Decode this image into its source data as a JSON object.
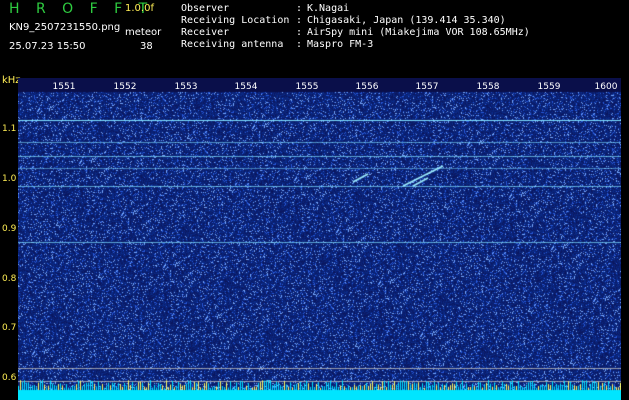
{
  "header": {
    "logo": "H R O F F T",
    "version": "1.0.0f",
    "filename": "KN9_2507231550.png",
    "mode": "meteor",
    "datetime": "25.07.23 15:50",
    "count": "38",
    "info": [
      {
        "label": "Observer",
        "value": "K.Nagai"
      },
      {
        "label": "Receiving Location",
        "value": "Chigasaki, Japan (139.414 35.340)"
      },
      {
        "label": "Receiver",
        "value": "AirSpy mini (Miakejima VOR 108.65MHz)"
      },
      {
        "label": "Receiving antenna",
        "value": "Maspro FM-3"
      }
    ],
    "separator": ":"
  },
  "axes": {
    "y_unit": "kHz",
    "y_ticks": [
      "1.1",
      "1.0",
      "0.9",
      "0.8",
      "0.7",
      "0.6"
    ],
    "x_ticks": [
      "1551",
      "1552",
      "1553",
      "1554",
      "1555",
      "1556",
      "1557",
      "1558",
      "1559",
      "1600"
    ]
  },
  "colors": {
    "background": "#000000",
    "spectrum_base": "#101a6e",
    "signal_line": "#7fe0ff",
    "noise_bar": "#00e5ff",
    "label_green": "#2ecc40",
    "label_yellow": "#ffee55"
  }
}
